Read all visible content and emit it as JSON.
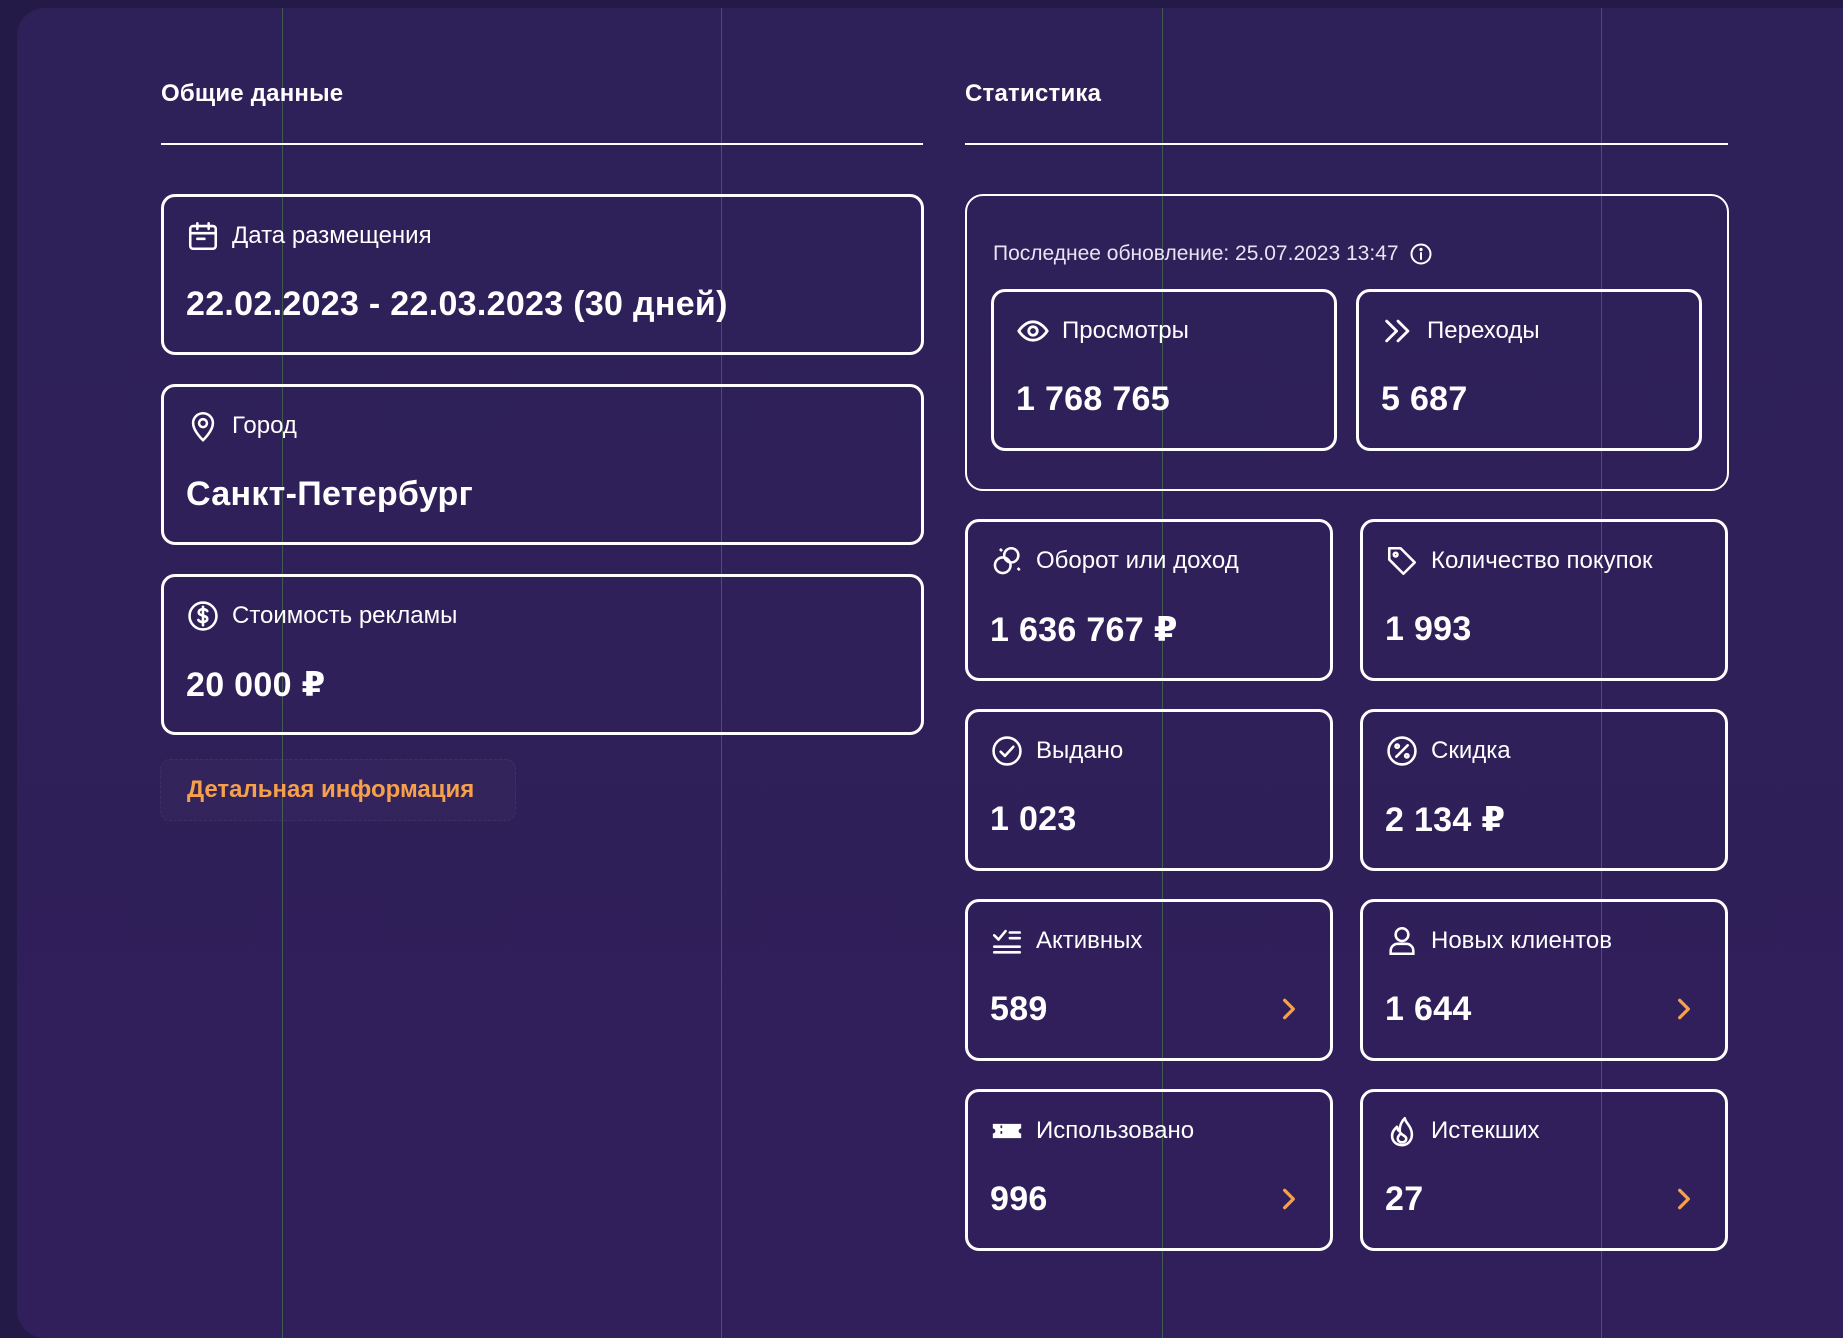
{
  "general": {
    "title": "Общие данные",
    "date": {
      "label": "Дата размещения",
      "value": "22.02.2023 - 22.03.2023 (30 дней)",
      "icon": "calendar-icon"
    },
    "city": {
      "label": "Город",
      "value": "Санкт-Петербург",
      "icon": "map-pin-icon"
    },
    "cost": {
      "label": "Стоимость рекламы",
      "value": "20 000 ₽",
      "icon": "dollar-circle-icon"
    },
    "detail_button": "Детальная информация"
  },
  "stats": {
    "title": "Статистика",
    "last_update": "Последнее обновление: 25.07.2023 13:47",
    "views": {
      "label": "Просмотры",
      "value": "1 768 765",
      "icon": "eye-icon"
    },
    "clicks": {
      "label": "Переходы",
      "value": "5 687",
      "icon": "double-chevron-icon"
    },
    "turnover": {
      "label": "Оборот или доход",
      "value": "1 636 767 ₽",
      "icon": "coins-icon"
    },
    "purchases": {
      "label": "Количество покупок",
      "value": "1 993",
      "icon": "tag-icon"
    },
    "issued": {
      "label": "Выдано",
      "value": "1 023",
      "icon": "check-circle-icon"
    },
    "discount": {
      "label": "Скидка",
      "value": "2 134 ₽",
      "icon": "percent-circle-icon"
    },
    "active": {
      "label": "Активных",
      "value": "589",
      "icon": "checklist-icon"
    },
    "new_clients": {
      "label": "Новых клиентов",
      "value": "1 644",
      "icon": "user-icon"
    },
    "used": {
      "label": "Использовано",
      "value": "996",
      "icon": "ticket-icon"
    },
    "expired": {
      "label": "Истекших",
      "value": "27",
      "icon": "flame-icon"
    }
  },
  "colors": {
    "background": "#2e2058",
    "accent": "#f7a04a",
    "border": "#ffffff"
  }
}
